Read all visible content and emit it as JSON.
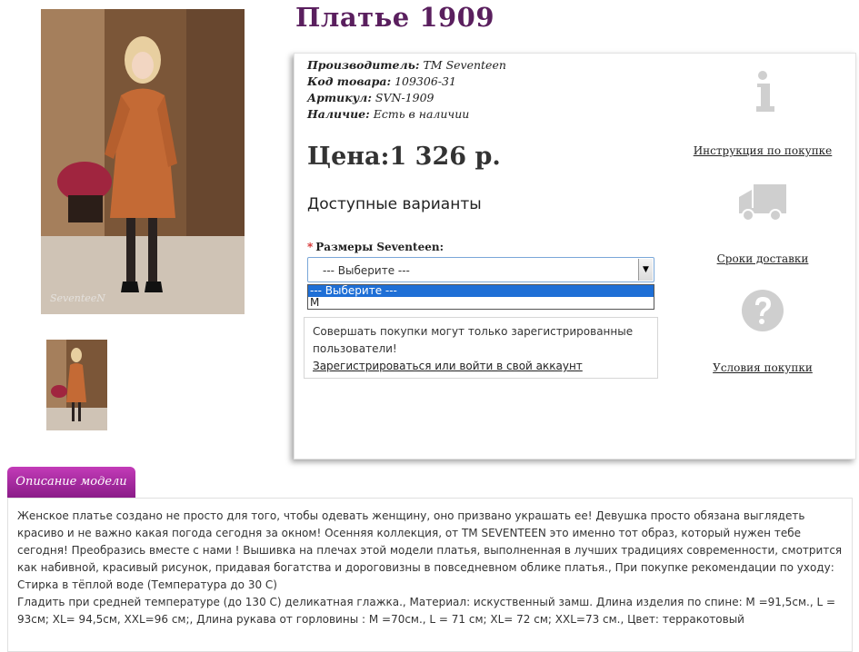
{
  "product": {
    "title": "Платье 1909",
    "manufacturer_label": "Производитель:",
    "manufacturer": "TM Seventeen",
    "code_label": "Код товара:",
    "code": "109306-31",
    "sku_label": "Артикул:",
    "sku": "SVN-1909",
    "stock_label": "Наличие:",
    "stock": "Есть в наличии",
    "price": "Цена:1 326 р.",
    "photo_watermark": "SeventeeN"
  },
  "options": {
    "title": "Доступные варианты",
    "required_mark": "*",
    "size_label": "Размеры Seventeen:",
    "selected": "--- Выберите ---",
    "dropdown": [
      "--- Выберите ---",
      "M"
    ]
  },
  "notice": {
    "text": "Совершать покупки могут только зарегистрированные пользователи!",
    "link": "Зарегистрироваться или войти в свой аккаунт"
  },
  "side": {
    "items": [
      {
        "icon": "info-icon",
        "label": "Инструкция по покупке"
      },
      {
        "icon": "truck-icon",
        "label": "Сроки доставки"
      },
      {
        "icon": "question-icon",
        "label": "Условия покупки"
      }
    ],
    "icon_color": "#cfcfcf"
  },
  "tabs": {
    "description": "Описание модели"
  },
  "description": {
    "paragraph": "Женское платье создано не просто для того, чтобы одевать женщину, оно призвано украшать ее! Девушка просто обязана выглядеть красиво и не важно какая погода сегодня за окном! Осенняя коллекция, от TM SEVENTEEN это именно тот образ, который нужен тебе сегодня! Преобразись вместе с нами ! Вышивка на плечах этой модели платья, выполненная в лучших традициях современности, смотрится как набивной, красивый рисунок, придавая богатства и дороговизны в повседневном облике платья., При покупке рекомендации по уходу:",
    "care": "Стирка в тёплой воде (Температура до 30 С)",
    "details": "Гладить при средней температуре (до 130 С) деликатная глажка., Материал: искуственный замш. Длина изделия по спине: M =91,5см., L = 93см; XL= 94,5см, XXL=96 см;, Длина рукава от горловины : M =70см., L = 71 см; XL= 72 см; XXL=73 см., Цвет: терракотовый"
  },
  "colors": {
    "title": "#5a1f5e",
    "tab": "#a0259e",
    "select_highlight": "#1e6fd6",
    "dress": "#c46a35"
  }
}
